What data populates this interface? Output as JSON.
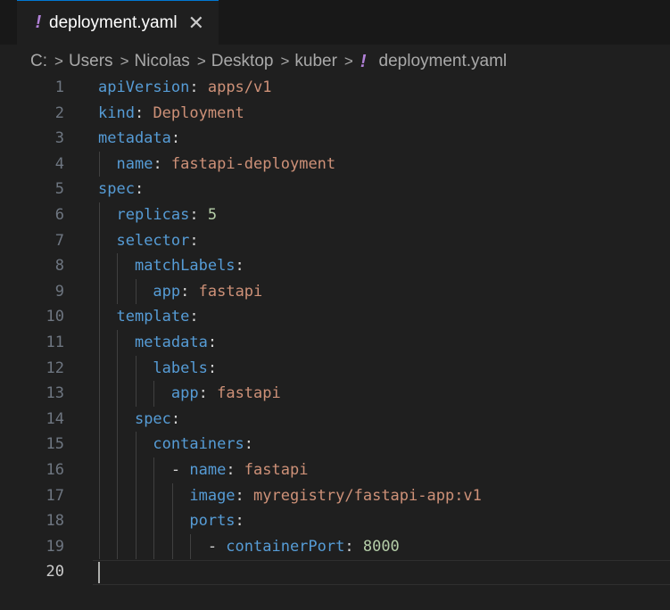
{
  "tab": {
    "icon": "!",
    "label": "deployment.yaml",
    "close": "✕"
  },
  "breadcrumb": {
    "items": [
      "C:",
      "Users",
      "Nicolas",
      "Desktop",
      "kuber"
    ],
    "file_icon": "!",
    "file": "deployment.yaml",
    "separator": ">"
  },
  "editor": {
    "active_line": 20,
    "lines": [
      {
        "n": "1",
        "tokens": [
          {
            "t": "k",
            "s": "apiVersion"
          },
          {
            "t": "p",
            "s": ": "
          },
          {
            "t": "v",
            "s": "apps/v1"
          }
        ]
      },
      {
        "n": "2",
        "tokens": [
          {
            "t": "k",
            "s": "kind"
          },
          {
            "t": "p",
            "s": ": "
          },
          {
            "t": "v",
            "s": "Deployment"
          }
        ]
      },
      {
        "n": "3",
        "tokens": [
          {
            "t": "k",
            "s": "metadata"
          },
          {
            "t": "p",
            "s": ":"
          }
        ]
      },
      {
        "n": "4",
        "tokens": [
          {
            "t": "p",
            "s": "  "
          },
          {
            "t": "k",
            "s": "name"
          },
          {
            "t": "p",
            "s": ": "
          },
          {
            "t": "v",
            "s": "fastapi-deployment"
          }
        ]
      },
      {
        "n": "5",
        "tokens": [
          {
            "t": "k",
            "s": "spec"
          },
          {
            "t": "p",
            "s": ":"
          }
        ]
      },
      {
        "n": "6",
        "tokens": [
          {
            "t": "p",
            "s": "  "
          },
          {
            "t": "k",
            "s": "replicas"
          },
          {
            "t": "p",
            "s": ": "
          },
          {
            "t": "n",
            "s": "5"
          }
        ]
      },
      {
        "n": "7",
        "tokens": [
          {
            "t": "p",
            "s": "  "
          },
          {
            "t": "k",
            "s": "selector"
          },
          {
            "t": "p",
            "s": ":"
          }
        ]
      },
      {
        "n": "8",
        "tokens": [
          {
            "t": "p",
            "s": "    "
          },
          {
            "t": "k",
            "s": "matchLabels"
          },
          {
            "t": "p",
            "s": ":"
          }
        ]
      },
      {
        "n": "9",
        "tokens": [
          {
            "t": "p",
            "s": "      "
          },
          {
            "t": "k",
            "s": "app"
          },
          {
            "t": "p",
            "s": ": "
          },
          {
            "t": "v",
            "s": "fastapi"
          }
        ]
      },
      {
        "n": "10",
        "tokens": [
          {
            "t": "p",
            "s": "  "
          },
          {
            "t": "k",
            "s": "template"
          },
          {
            "t": "p",
            "s": ":"
          }
        ]
      },
      {
        "n": "11",
        "tokens": [
          {
            "t": "p",
            "s": "    "
          },
          {
            "t": "k",
            "s": "metadata"
          },
          {
            "t": "p",
            "s": ":"
          }
        ]
      },
      {
        "n": "12",
        "tokens": [
          {
            "t": "p",
            "s": "      "
          },
          {
            "t": "k",
            "s": "labels"
          },
          {
            "t": "p",
            "s": ":"
          }
        ]
      },
      {
        "n": "13",
        "tokens": [
          {
            "t": "p",
            "s": "        "
          },
          {
            "t": "k",
            "s": "app"
          },
          {
            "t": "p",
            "s": ": "
          },
          {
            "t": "v",
            "s": "fastapi"
          }
        ]
      },
      {
        "n": "14",
        "tokens": [
          {
            "t": "p",
            "s": "    "
          },
          {
            "t": "k",
            "s": "spec"
          },
          {
            "t": "p",
            "s": ":"
          }
        ]
      },
      {
        "n": "15",
        "tokens": [
          {
            "t": "p",
            "s": "      "
          },
          {
            "t": "k",
            "s": "containers"
          },
          {
            "t": "p",
            "s": ":"
          }
        ]
      },
      {
        "n": "16",
        "tokens": [
          {
            "t": "p",
            "s": "        - "
          },
          {
            "t": "k",
            "s": "name"
          },
          {
            "t": "p",
            "s": ": "
          },
          {
            "t": "v",
            "s": "fastapi"
          }
        ]
      },
      {
        "n": "17",
        "tokens": [
          {
            "t": "p",
            "s": "          "
          },
          {
            "t": "k",
            "s": "image"
          },
          {
            "t": "p",
            "s": ": "
          },
          {
            "t": "v",
            "s": "myregistry/fastapi-app:v1"
          }
        ]
      },
      {
        "n": "18",
        "tokens": [
          {
            "t": "p",
            "s": "          "
          },
          {
            "t": "k",
            "s": "ports"
          },
          {
            "t": "p",
            "s": ":"
          }
        ]
      },
      {
        "n": "19",
        "tokens": [
          {
            "t": "p",
            "s": "            - "
          },
          {
            "t": "k",
            "s": "containerPort"
          },
          {
            "t": "p",
            "s": ": "
          },
          {
            "t": "n",
            "s": "8000"
          }
        ]
      },
      {
        "n": "20",
        "tokens": []
      }
    ]
  },
  "colors": {
    "key": "#569cd6",
    "string": "#ce9178",
    "number": "#b5cea8",
    "yaml_icon": "#b180d7"
  }
}
